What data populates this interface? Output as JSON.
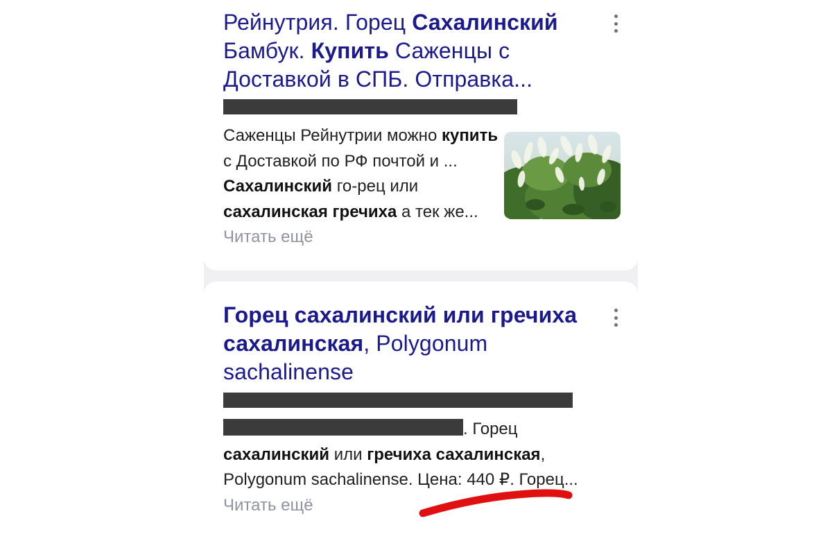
{
  "results": [
    {
      "title_parts": [
        {
          "text": "Рейнутрия. Горец ",
          "bold": false
        },
        {
          "text": "Сахалинский",
          "bold": true
        },
        {
          "text": " Бамбук. ",
          "bold": false
        },
        {
          "text": "Купить",
          "bold": true
        },
        {
          "text": " Саженцы с Доставкой в СПБ. Отправка...",
          "bold": false
        }
      ],
      "snippet_parts": [
        {
          "text": "Саженцы Рейнутрии можно ",
          "bold": false
        },
        {
          "text": "купить",
          "bold": true
        },
        {
          "text": " с Доставкой по РФ почтой и ... ",
          "bold": false
        },
        {
          "text": "Сахалинский",
          "bold": true
        },
        {
          "text": " го-рец или ",
          "bold": false
        },
        {
          "text": "сахалинская гречиха",
          "bold": true
        },
        {
          "text": " а тек же... ",
          "bold": false
        }
      ],
      "read_more": "Читать ещё",
      "thumbnail": "knotweed-flowers-photo"
    },
    {
      "title_parts": [
        {
          "text": "Горец сахалинский или гречиха сахалинская",
          "bold": true
        },
        {
          "text": ", Polygonum sachalinense",
          "bold": false
        }
      ],
      "snippet_parts": [
        {
          "text": ". Горец ",
          "bold": false
        },
        {
          "text": "сахалинский",
          "bold": true
        },
        {
          "text": " или ",
          "bold": false
        },
        {
          "text": "гречиха сахалинская",
          "bold": true
        },
        {
          "text": ", Polygonum sachalinense. Цена: 440 ₽. Горец... ",
          "bold": false
        }
      ],
      "read_more": "Читать ещё"
    }
  ],
  "colors": {
    "title": "#1a1a8e",
    "snippet": "#1f1f1f",
    "read_more": "#8f93a0",
    "redaction": "#3b3b3b",
    "annotation": "#e01010"
  },
  "icons": {
    "more_menu": "vertical-dots-icon"
  }
}
